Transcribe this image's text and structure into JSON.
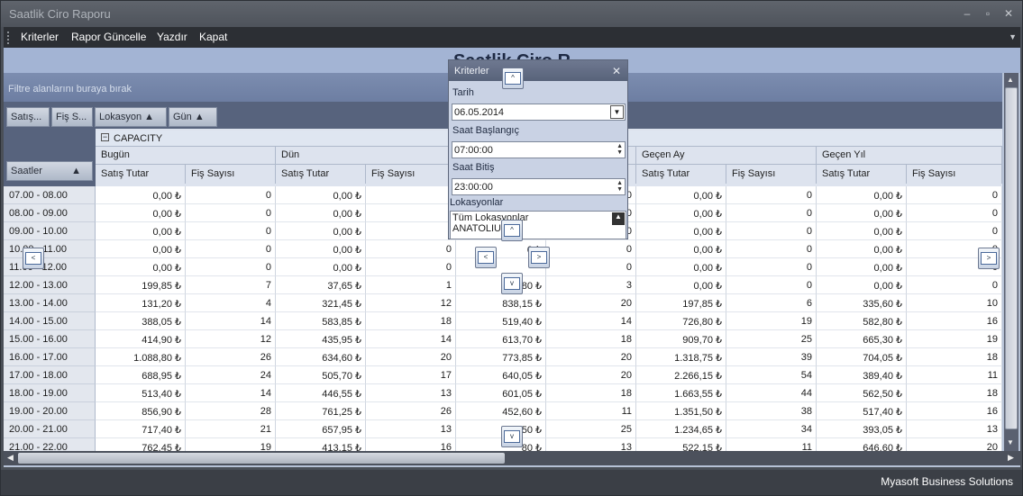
{
  "window": {
    "title": "Saatlik Ciro Raporu",
    "buttons": [
      "–",
      "▫",
      "✕"
    ]
  },
  "menu": [
    "Kriterler",
    "Rapor Güncelle",
    "Yazdır",
    "Kapat"
  ],
  "report_title": "Saatlik Ciro R",
  "filter_hint": "Filtre alanlarını buraya bırak",
  "field_buttons": [
    "Satış...",
    "Fiş S...",
    "Lokasyon ▲",
    "Gün ▲"
  ],
  "row_field": "Saatler",
  "capacity": "CAPACITY",
  "groups": [
    "Bugün",
    "Dün",
    "Geçen Ay",
    "Geçen Yıl"
  ],
  "sub": {
    "satis": "Satış Tutar",
    "fis": "Fiş Sayısı"
  },
  "rows": [
    [
      "07.00 - 08.00",
      "0,00 ₺",
      "0",
      "0,00 ₺",
      "",
      "",
      "0",
      "0,00 ₺",
      "0",
      "0,00 ₺",
      "0"
    ],
    [
      "08.00 - 09.00",
      "0,00 ₺",
      "0",
      "0,00 ₺",
      "",
      "",
      "0",
      "0,00 ₺",
      "0",
      "0,00 ₺",
      "0"
    ],
    [
      "09.00 - 10.00",
      "0,00 ₺",
      "0",
      "0,00 ₺",
      "",
      "",
      "0",
      "0,00 ₺",
      "0",
      "0,00 ₺",
      "0"
    ],
    [
      "10.00 - 11.00",
      "0,00 ₺",
      "0",
      "0,00 ₺",
      "0",
      "0 ₺",
      "0",
      "0,00 ₺",
      "0",
      "0,00 ₺",
      "0"
    ],
    [
      "11.00 - 12.00",
      "0,00 ₺",
      "0",
      "0,00 ₺",
      "0",
      "",
      "0",
      "0,00 ₺",
      "0",
      "0,00 ₺",
      "0"
    ],
    [
      "12.00 - 13.00",
      "199,85 ₺",
      "7",
      "37,65 ₺",
      "1",
      "80 ₺",
      "3",
      "0,00 ₺",
      "0",
      "0,00 ₺",
      "0"
    ],
    [
      "13.00 - 14.00",
      "131,20 ₺",
      "4",
      "321,45 ₺",
      "12",
      "838,15 ₺",
      "20",
      "197,85 ₺",
      "6",
      "335,60 ₺",
      "10"
    ],
    [
      "14.00 - 15.00",
      "388,05 ₺",
      "14",
      "583,85 ₺",
      "18",
      "519,40 ₺",
      "14",
      "726,80 ₺",
      "19",
      "582,80 ₺",
      "16"
    ],
    [
      "15.00 - 16.00",
      "414,90 ₺",
      "12",
      "435,95 ₺",
      "14",
      "613,70 ₺",
      "18",
      "909,70 ₺",
      "25",
      "665,30 ₺",
      "19"
    ],
    [
      "16.00 - 17.00",
      "1.088,80 ₺",
      "26",
      "634,60 ₺",
      "20",
      "773,85 ₺",
      "20",
      "1.318,75 ₺",
      "39",
      "704,05 ₺",
      "18"
    ],
    [
      "17.00 - 18.00",
      "688,95 ₺",
      "24",
      "505,70 ₺",
      "17",
      "640,05 ₺",
      "20",
      "2.266,15 ₺",
      "54",
      "389,40 ₺",
      "11"
    ],
    [
      "18.00 - 19.00",
      "513,40 ₺",
      "14",
      "446,55 ₺",
      "13",
      "601,05 ₺",
      "18",
      "1.663,55 ₺",
      "44",
      "562,50 ₺",
      "18"
    ],
    [
      "19.00 - 20.00",
      "856,90 ₺",
      "28",
      "761,25 ₺",
      "26",
      "452,60 ₺",
      "11",
      "1.351,50 ₺",
      "38",
      "517,40 ₺",
      "16"
    ],
    [
      "20.00 - 21.00",
      "717,40 ₺",
      "21",
      "657,95 ₺",
      "13",
      "50 ₺",
      "25",
      "1.234,65 ₺",
      "34",
      "393,05 ₺",
      "13"
    ],
    [
      "21.00 - 22.00",
      "762,45 ₺",
      "19",
      "413,15 ₺",
      "16",
      "80 ₺",
      "13",
      "522,15 ₺",
      "11",
      "646,60 ₺",
      "20"
    ]
  ],
  "dialog": {
    "title": "Kriterler",
    "tarih_label": "Tarih",
    "tarih_value": "06.05.2014",
    "start_label": "Saat Başlangıç",
    "start_value": "07:00:00",
    "end_label": "Saat Bitiş",
    "end_value": "23:00:00",
    "lokasyon_label": "Lokasyonlar",
    "lokasyonlar": [
      "Tüm Lokasyonlar",
      "ANATOLIUM"
    ]
  },
  "status": "Myasoft Business Solutions"
}
